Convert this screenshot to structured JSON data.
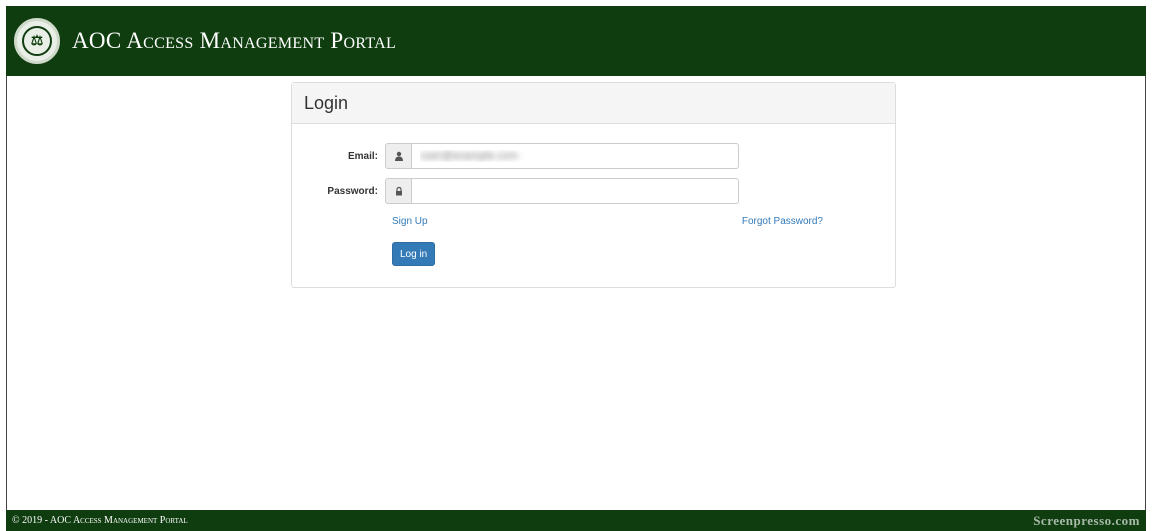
{
  "header": {
    "title": "AOC Access Management Portal",
    "logo_icon": "seal-icon"
  },
  "login": {
    "heading": "Login",
    "email_label": "Email:",
    "email_value": "user@example.com",
    "password_label": "Password:",
    "password_value": "",
    "signup_link": "Sign Up",
    "forgot_link": "Forgot Password?",
    "login_button": "Log in"
  },
  "icons": {
    "email": "user-icon",
    "password": "lock-icon"
  },
  "footer": {
    "copyright": "© 2019 - AOC Access Management Portal",
    "watermark": "Screenpresso.com"
  },
  "colors": {
    "brand_green": "#0f3d0f",
    "primary_button": "#337ab7",
    "link": "#337ab7"
  }
}
